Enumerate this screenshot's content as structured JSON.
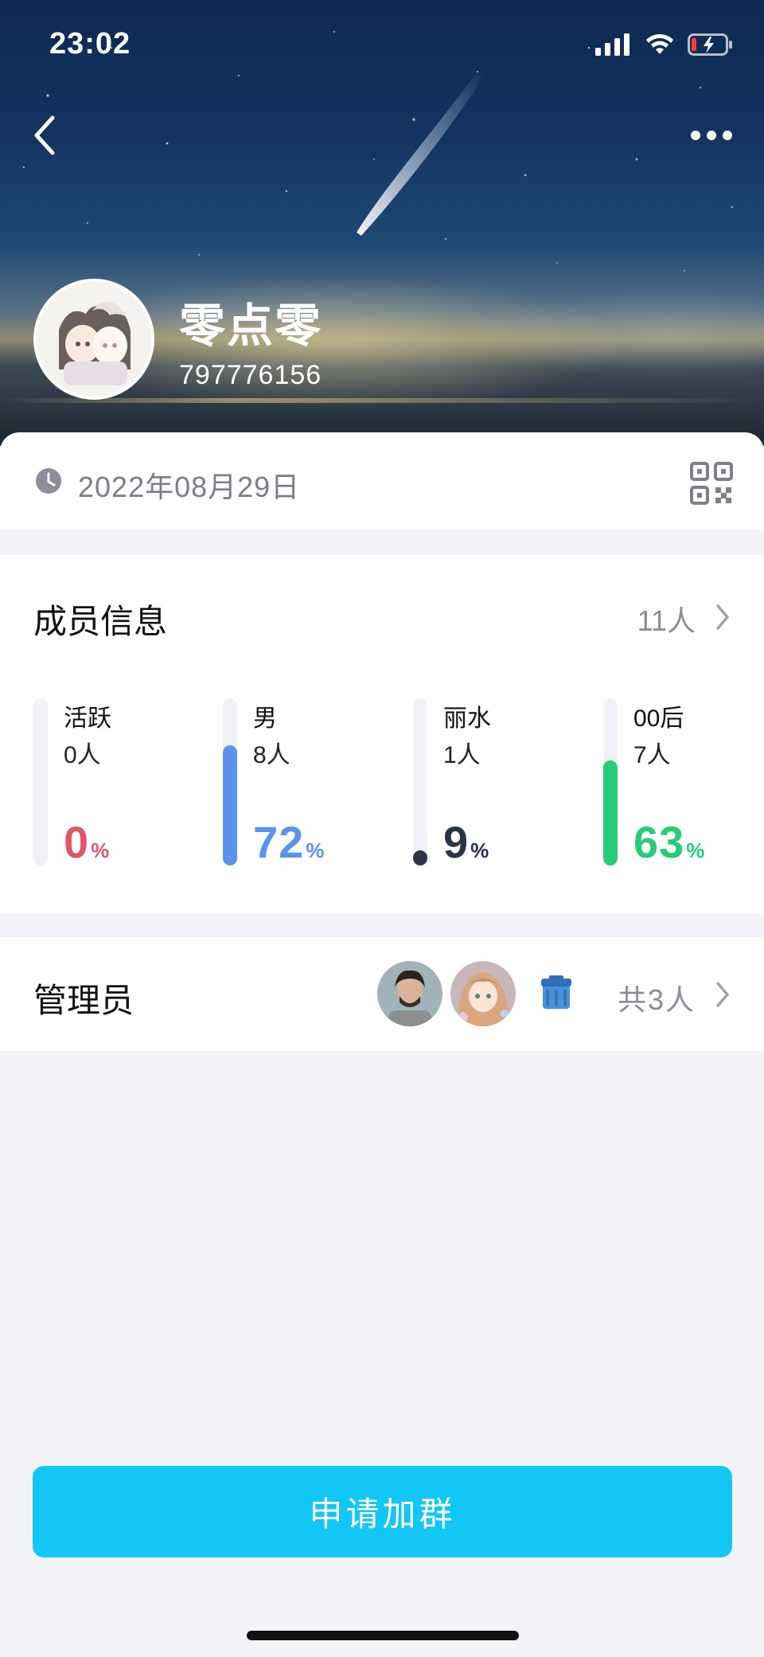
{
  "status_bar": {
    "time": "23:02"
  },
  "header": {
    "group_name": "零点零",
    "group_id": "797776156",
    "icons": {
      "back": "chevron-left-icon",
      "more": "more-dots-icon"
    }
  },
  "info": {
    "created_date": "2022年08月29日",
    "icons": {
      "date": "clock-icon",
      "qr": "qr-code-icon"
    }
  },
  "members": {
    "title": "成员信息",
    "count": "11人",
    "stats": [
      {
        "label": "活跃",
        "people": "0人",
        "percent": "0",
        "unit": "%",
        "fraction": 0.0,
        "color": "#e05567"
      },
      {
        "label": "男",
        "people": "8人",
        "percent": "72",
        "unit": "%",
        "fraction": 0.72,
        "color": "#5b93ea"
      },
      {
        "label": "丽水",
        "people": "1人",
        "percent": "9",
        "unit": "%",
        "fraction": 0.09,
        "color": "#2a3348"
      },
      {
        "label": "00后",
        "people": "7人",
        "percent": "63",
        "unit": "%",
        "fraction": 0.63,
        "color": "#27cc77"
      }
    ]
  },
  "admins": {
    "title": "管理员",
    "total": "共3人",
    "avatars": [
      "admin-avatar-1",
      "admin-avatar-2",
      "admin-avatar-3"
    ]
  },
  "actions": {
    "join_label": "申请加群"
  },
  "colors": {
    "accent": "#12c6f5",
    "muted_text": "#8a8d94",
    "background": "#f2f3f7"
  }
}
